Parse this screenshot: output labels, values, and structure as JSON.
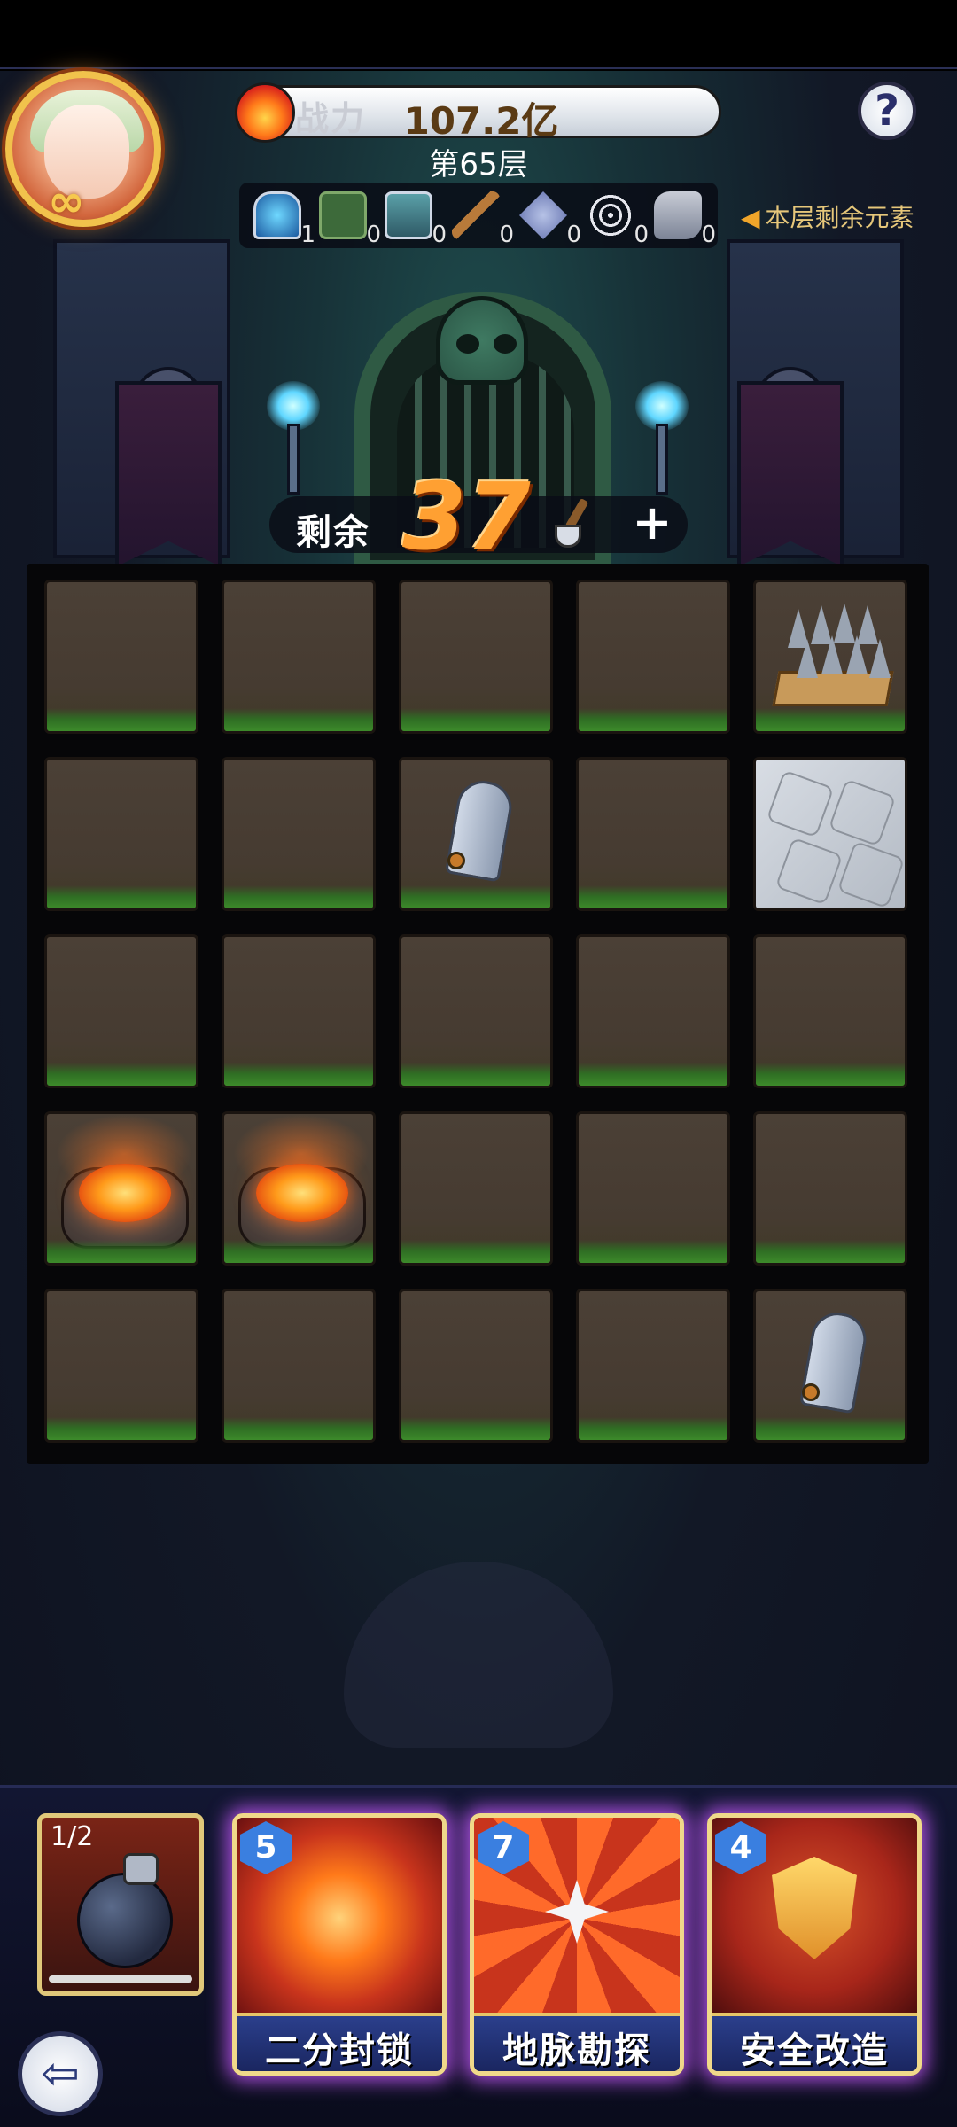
{
  "header": {
    "power_label": "战力",
    "power_value": "107.2亿",
    "floor_label": "第65层",
    "help_label": "?"
  },
  "elements_bar": {
    "label": "本层剩余元素",
    "items": [
      {
        "icon": "portal-icon",
        "count": "1"
      },
      {
        "icon": "forbidden-icon",
        "count": "0"
      },
      {
        "icon": "treasure-chest-icon",
        "count": "0"
      },
      {
        "icon": "shovel-icon",
        "count": "0"
      },
      {
        "icon": "crossed-swords-icon",
        "count": "0"
      },
      {
        "icon": "spider-web-icon",
        "count": "0"
      },
      {
        "icon": "puzzle-icon",
        "count": "0"
      }
    ]
  },
  "remaining": {
    "label": "剩余",
    "count": "37",
    "plus_label": "+"
  },
  "grid": {
    "rows": [
      [
        "dirt",
        "dirt",
        "dirt",
        "dirt",
        "spikes"
      ],
      [
        "dirt",
        "dirt",
        "tombstone",
        "dirt",
        "stone"
      ],
      [
        "dirt",
        "dirt",
        "dirt",
        "dirt",
        "dirt"
      ],
      [
        "lava",
        "lava",
        "dirt",
        "dirt",
        "dirt"
      ],
      [
        "dirt",
        "dirt",
        "dirt",
        "dirt",
        "tombstone"
      ]
    ]
  },
  "cards": {
    "bomb": {
      "counter": "1/2",
      "icon": "bomb-icon"
    },
    "skills": [
      {
        "cost": "5",
        "name": "二分封锁",
        "icon": "chain-icon",
        "color": "#c8341c"
      },
      {
        "cost": "7",
        "name": "地脉勘探",
        "icon": "move-arrows-icon",
        "color": "#c8341c"
      },
      {
        "cost": "4",
        "name": "安全改造",
        "icon": "shield-icon",
        "color": "#a8261a"
      }
    ]
  },
  "colors": {
    "accent_orange": "#ffa032",
    "skill_glow": "#c85aff",
    "label_gold": "#e6c77a"
  }
}
